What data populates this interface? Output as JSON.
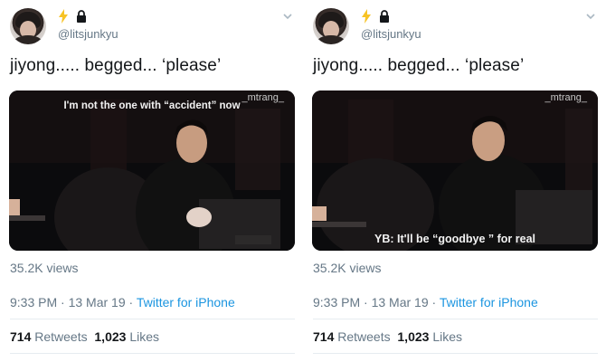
{
  "tweets": [
    {
      "badges": [
        "lightning-bolt",
        "lock"
      ],
      "handle": "@litsjunkyu",
      "text": "jiyong..... begged... ‘please’",
      "media": {
        "watermark": "_mtrang_",
        "caption_top": "I'm not the one with “accident” now",
        "caption_bottom": ""
      },
      "views": "35.2K views",
      "time": "9:33 PM · 13 Mar 19 ·",
      "source": "Twitter for iPhone",
      "retweets": "714",
      "retweets_label": "Retweets",
      "likes": "1,023",
      "likes_label": "Likes"
    },
    {
      "badges": [
        "lightning-bolt",
        "lock"
      ],
      "handle": "@litsjunkyu",
      "text": "jiyong..... begged... ‘please’",
      "media": {
        "watermark": "_mtrang_",
        "caption_top": "",
        "caption_bottom": "YB: It'll be “goodbye ” for real"
      },
      "views": "35.2K views",
      "time": "9:33 PM · 13 Mar 19 ·",
      "source": "Twitter for iPhone",
      "retweets": "714",
      "retweets_label": "Retweets",
      "likes": "1,023",
      "likes_label": "Likes"
    }
  ],
  "colors": {
    "bolt": "#f7c325",
    "secondary_text": "#657786",
    "link": "#1b95e0",
    "divider": "#e6ecf0"
  }
}
